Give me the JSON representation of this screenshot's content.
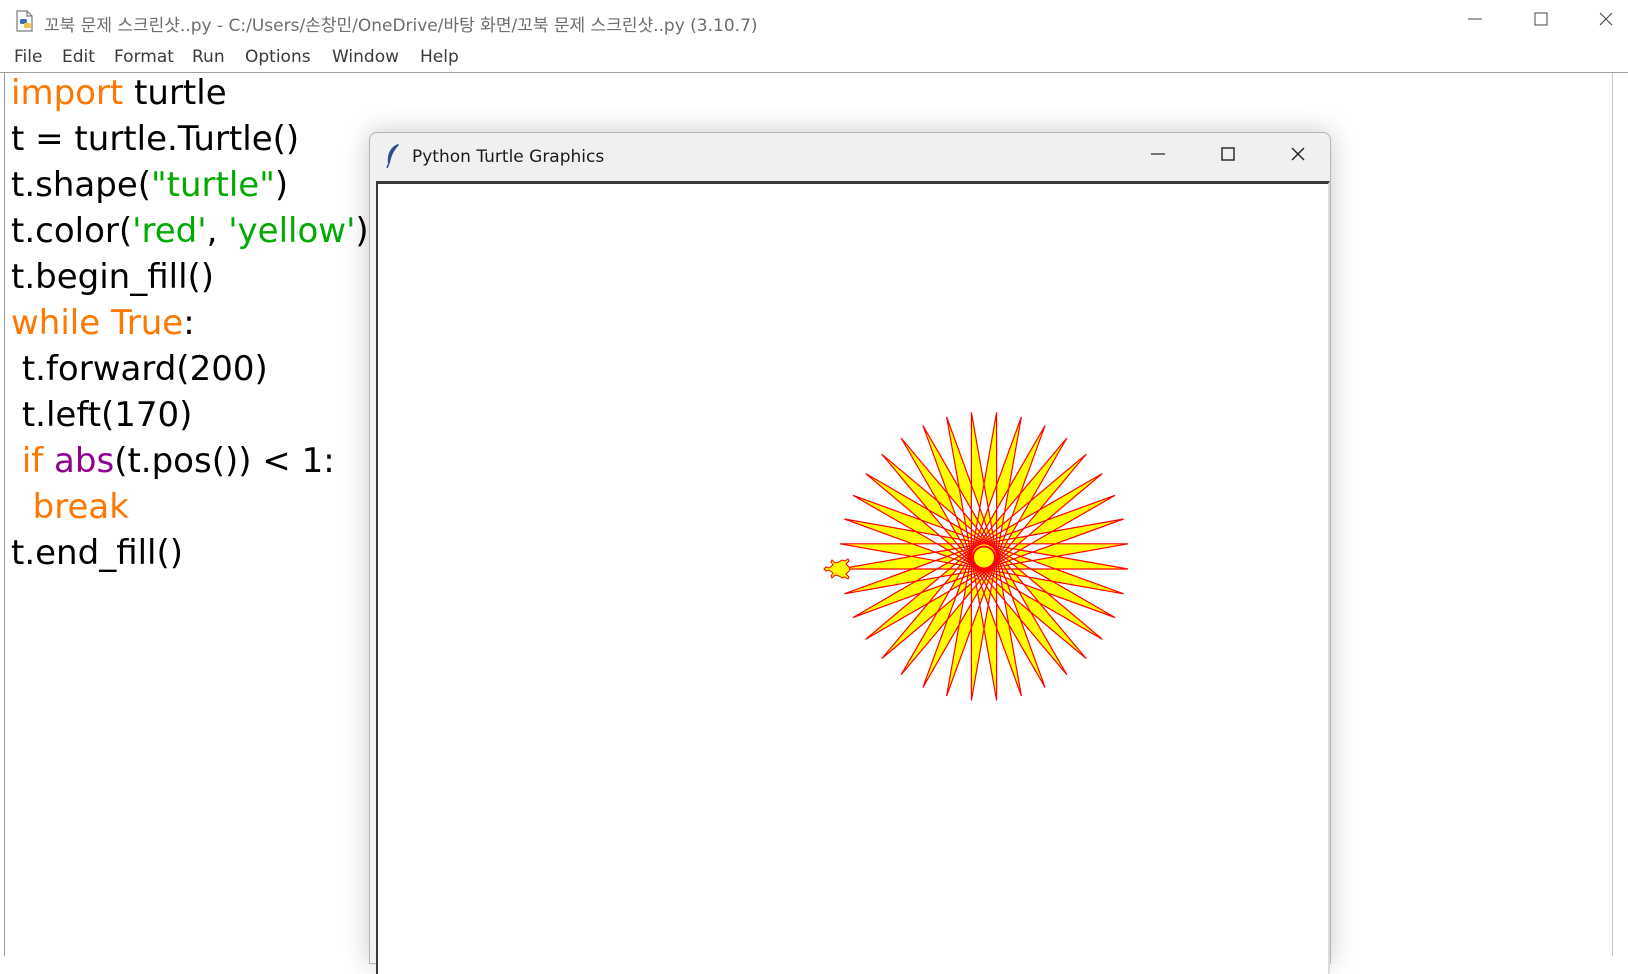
{
  "editor": {
    "title": "꼬북 문제 스크린샷..py - C:/Users/손창민/OneDrive/바탕 화면/꼬북 문제 스크린샷..py (3.10.7)",
    "menu": [
      "File",
      "Edit",
      "Format",
      "Run",
      "Options",
      "Window",
      "Help"
    ],
    "code": [
      {
        "indent": "",
        "tokens": [
          [
            "kw",
            "import"
          ],
          [
            "plain",
            " turtle"
          ]
        ]
      },
      {
        "indent": "",
        "tokens": [
          [
            "plain",
            "t = turtle.Turtle()"
          ]
        ]
      },
      {
        "indent": "",
        "tokens": [
          [
            "plain",
            "t.shape("
          ],
          [
            "str",
            "\"turtle\""
          ],
          [
            "plain",
            ")"
          ]
        ]
      },
      {
        "indent": "",
        "tokens": [
          [
            "plain",
            "t.color("
          ],
          [
            "str",
            "'red'"
          ],
          [
            "plain",
            ", "
          ],
          [
            "str",
            "'yellow'"
          ],
          [
            "plain",
            ")"
          ]
        ]
      },
      {
        "indent": "",
        "tokens": [
          [
            "plain",
            "t.begin_fill()"
          ]
        ]
      },
      {
        "indent": "",
        "tokens": [
          [
            "kw",
            "while"
          ],
          [
            "plain",
            " "
          ],
          [
            "kw",
            "True"
          ],
          [
            "plain",
            ":"
          ]
        ]
      },
      {
        "indent": " ",
        "tokens": [
          [
            "plain",
            "t.forward(200)"
          ]
        ]
      },
      {
        "indent": " ",
        "tokens": [
          [
            "plain",
            "t.left(170)"
          ]
        ]
      },
      {
        "indent": " ",
        "tokens": [
          [
            "kw",
            "if"
          ],
          [
            "plain",
            " "
          ],
          [
            "bi",
            "abs"
          ],
          [
            "plain",
            "(t.pos()) < 1:"
          ]
        ]
      },
      {
        "indent": "  ",
        "tokens": [
          [
            "kw",
            "break"
          ]
        ]
      },
      {
        "indent": "",
        "tokens": [
          [
            "plain",
            "t.end_fill()"
          ]
        ]
      }
    ]
  },
  "turtle_window": {
    "title": "Python Turtle Graphics",
    "drawing": {
      "shape": "turtle",
      "pen_color": "#ff0000",
      "fill_color": "#ffff00",
      "forward": 200,
      "left_angle": 170
    }
  },
  "colors": {
    "keyword": "#ff7700",
    "string": "#00aa00",
    "builtin": "#900090"
  },
  "icons": {
    "file_icon": "python-file-icon",
    "feather_icon": "feather-icon",
    "minimize": "minimize-icon",
    "maximize": "maximize-icon",
    "close": "close-icon"
  }
}
